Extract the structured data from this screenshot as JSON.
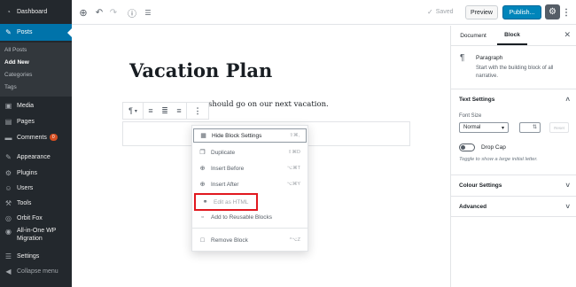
{
  "sidebar": {
    "items": [
      {
        "label": "Dashboard",
        "icon": "dashboard-icon",
        "glyph": "◔"
      },
      {
        "label": "Posts",
        "icon": "pin-icon",
        "glyph": "📌"
      },
      {
        "label": "Media",
        "icon": "media-icon",
        "glyph": "▣"
      },
      {
        "label": "Pages",
        "icon": "pages-icon",
        "glyph": "▤"
      },
      {
        "label": "Comments",
        "icon": "comments-icon",
        "glyph": "▬",
        "badge": "0"
      },
      {
        "label": "Appearance",
        "icon": "appearance-icon",
        "glyph": "✎"
      },
      {
        "label": "Plugins",
        "icon": "plugins-icon",
        "glyph": "⚙"
      },
      {
        "label": "Users",
        "icon": "users-icon",
        "glyph": "☺"
      },
      {
        "label": "Tools",
        "icon": "tools-icon",
        "glyph": "⚒"
      },
      {
        "label": "Orbit Fox",
        "icon": "orbit-fox-icon",
        "glyph": "◎"
      },
      {
        "label": "All-in-One WP",
        "label2": "Migration",
        "icon": "migration-icon",
        "glyph": "◉"
      },
      {
        "label": "Settings",
        "icon": "settings-icon",
        "glyph": "☰"
      },
      {
        "label": "Collapse menu",
        "icon": "collapse-icon",
        "glyph": "◀"
      }
    ],
    "submenu": [
      "All Posts",
      "Add New",
      "Categories",
      "Tags"
    ]
  },
  "topbar": {
    "saved": "Saved",
    "preview": "Preview",
    "publish": "Publish...",
    "add_glyph": "⊕",
    "undo_glyph": "↶",
    "redo_glyph": "↷",
    "info_glyph": "ⓘ",
    "outline_glyph": "☰",
    "gear_glyph": "⚙",
    "more_glyph": "⋮",
    "check_glyph": "✓"
  },
  "editor": {
    "title": "Vacation Plan",
    "paragraph": "should go on our next vacation."
  },
  "block_toolbar": {
    "para_glyph": "¶",
    "caret_glyph": "▾",
    "align_left_glyph": "≡",
    "align_center_glyph": "≣",
    "align_right_glyph": "≡",
    "more_glyph": "⋮"
  },
  "more_menu": {
    "items": [
      {
        "label": "Hide Block Settings",
        "shortcut": "⇧⌘,",
        "glyph": "▦"
      },
      {
        "label": "Duplicate",
        "shortcut": "⇧⌘D",
        "glyph": "❐"
      },
      {
        "label": "Insert Before",
        "shortcut": "⌥⌘T",
        "glyph": "⊕"
      },
      {
        "label": "Insert After",
        "shortcut": "⌥⌘Y",
        "glyph": "⊕"
      },
      {
        "label": "Edit as HTML",
        "shortcut": "",
        "glyph": "⚭"
      },
      {
        "label": "Add to Reusable Blocks",
        "shortcut": "",
        "glyph": "▫"
      },
      {
        "label": "Remove Block",
        "shortcut": "^⌥Z",
        "glyph": "□"
      }
    ]
  },
  "settings": {
    "tab_document": "Document",
    "tab_block": "Block",
    "close_glyph": "✕",
    "block_glyph": "¶",
    "block_name": "Paragraph",
    "block_desc": "Start with the building block of all narrative.",
    "text_settings": "Text Settings",
    "font_size_label": "Font Size",
    "font_size_value": "Normal",
    "reset": "Reset",
    "drop_cap": "Drop Cap",
    "drop_cap_help": "Toggle to show a large initial letter.",
    "colour_settings": "Colour Settings",
    "advanced": "Advanced",
    "chev_up": "˄",
    "chev_down": "˅",
    "sel_chev": "▾",
    "spin_glyph": "⇅"
  },
  "colors": {
    "admin_bg": "#23282d",
    "active_blue": "#0073aa",
    "publish_blue": "#0085ba",
    "highlight_red": "#e1181f"
  }
}
